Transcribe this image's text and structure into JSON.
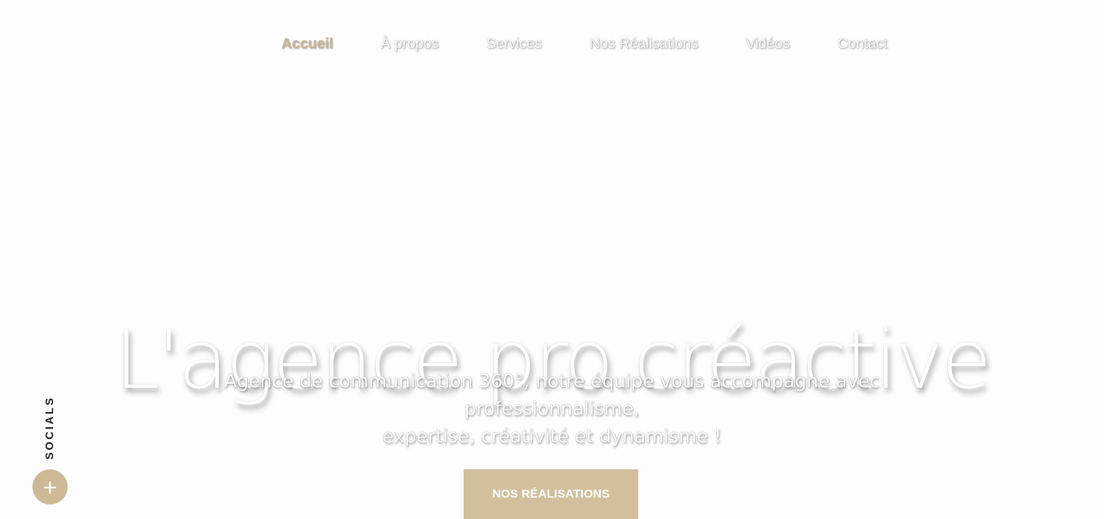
{
  "nav": {
    "items": [
      {
        "label": "Accueil",
        "active": true
      },
      {
        "label": "À propos",
        "active": false
      },
      {
        "label": "Services",
        "active": false
      },
      {
        "label": "Nos Réalisations",
        "active": false
      },
      {
        "label": "Vidéos",
        "active": false
      },
      {
        "label": "Contact",
        "active": false
      }
    ]
  },
  "hero": {
    "title": "L'agence pro.créactive",
    "subtitle_line1": "Agence de communication 360°, notre équipe vous accompagne avec professionnalisme,",
    "subtitle_line2": "expertise, créativité et dynamisme !",
    "cta_label": "NOS RÉALISATIONS"
  },
  "socials": {
    "label": "SOCIALS",
    "toggle_symbol": "+"
  },
  "colors": {
    "accent": "#d2bf9c",
    "active_nav": "#cbb795",
    "background": "#fefdfe",
    "text_light": "#ffffff",
    "text_dark": "#1e1e1e"
  }
}
